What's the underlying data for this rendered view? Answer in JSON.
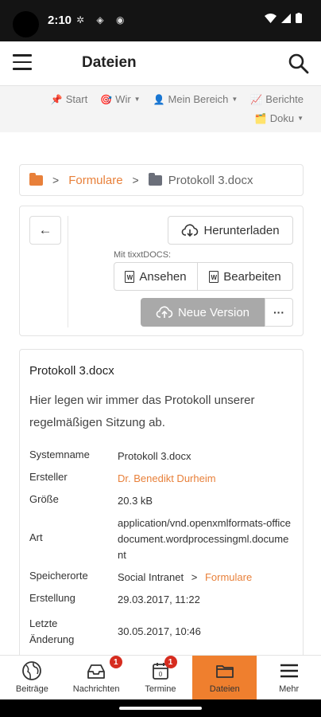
{
  "status": {
    "time": "2:10",
    "icons": "✲ ◈ ◉"
  },
  "appbar": {
    "title": "Dateien"
  },
  "topnav": [
    {
      "icon": "📌",
      "label": "Start",
      "caret": false
    },
    {
      "icon": "🎯",
      "label": "Wir",
      "caret": true
    },
    {
      "icon": "👤",
      "label": "Mein Bereich",
      "caret": true
    },
    {
      "icon": "📈",
      "label": "Berichte",
      "caret": false
    },
    {
      "icon": "🗂️",
      "label": "Doku",
      "caret": true
    }
  ],
  "breadcrumb": {
    "folder": "Formulare",
    "file": "Protokoll 3.docx",
    "folder_color": "#e8803a",
    "file_folder_color": "#6b6f7a"
  },
  "actions": {
    "download": "Herunterladen",
    "tixxt_label": "Mit tixxtDOCS:",
    "view": "Ansehen",
    "edit": "Bearbeiten",
    "new_version": "Neue Version",
    "more": "···"
  },
  "file": {
    "title": "Protokoll 3.docx",
    "description": "Hier legen wir immer das Protokoll unserer regelmäßigen Sitzung ab.",
    "rows": {
      "systemname": {
        "key": "Systemname",
        "value": "Protokoll 3.docx"
      },
      "ersteller": {
        "key": "Ersteller",
        "value": "Dr. Benedikt Durheim"
      },
      "groesse": {
        "key": "Größe",
        "value": "20.3 kB"
      },
      "art": {
        "key": "Art",
        "value": "application/vnd.openxmlformats-officedocument.wordprocessingml.document"
      },
      "speicherorte": {
        "key": "Speicherorte",
        "value": "Social Intranet",
        "link": "Formulare"
      },
      "erstellung": {
        "key": "Erstellung",
        "value": "29.03.2017, 11:22"
      },
      "aenderung": {
        "key": "Letzte Änderung",
        "value": "30.05.2017, 10:46"
      }
    }
  },
  "bottomnav": [
    {
      "label": "Beiträge",
      "icon": "globe-icon",
      "badge": ""
    },
    {
      "label": "Nachrichten",
      "icon": "inbox-icon",
      "badge": "1"
    },
    {
      "label": "Termine",
      "icon": "calendar-icon",
      "badge": "1"
    },
    {
      "label": "Dateien",
      "icon": "folder-icon",
      "badge": "",
      "active": true
    },
    {
      "label": "Mehr",
      "icon": "menu-icon",
      "badge": ""
    }
  ],
  "colors": {
    "accent": "#ef7f2e",
    "link": "#e8803a",
    "badge": "#d62c1f"
  }
}
